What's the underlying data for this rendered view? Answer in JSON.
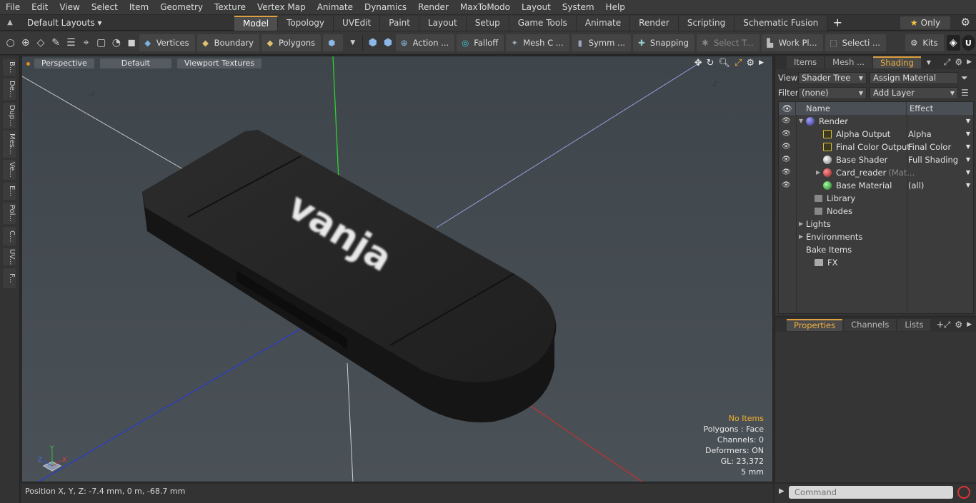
{
  "menu": [
    "File",
    "Edit",
    "View",
    "Select",
    "Item",
    "Geometry",
    "Texture",
    "Vertex Map",
    "Animate",
    "Dynamics",
    "Render",
    "MaxToModo",
    "Layout",
    "System",
    "Help"
  ],
  "layout": {
    "layouts_label": "Default Layouts ▾",
    "tabs": [
      "Model",
      "Topology",
      "UVEdit",
      "Paint",
      "Layout",
      "Setup",
      "Game Tools",
      "Animate",
      "Render",
      "Scripting",
      "Schematic Fusion"
    ],
    "active_tab": "Model",
    "only_label": "Only"
  },
  "toolbar": {
    "vertices": "Vertices",
    "boundary": "Boundary",
    "polygons": "Polygons",
    "action": "Action  ...",
    "falloff": "Falloff",
    "mesh": "Mesh C ...",
    "symm": "Symm ...",
    "snapping": "Snapping",
    "select_t": "Select T...",
    "work_pl": "Work Pl...",
    "selecti": "Selecti ...",
    "kits": "Kits"
  },
  "left_strip": [
    "B...",
    "De...",
    "Dup...",
    "Mes...",
    "Ve...",
    "E...",
    "Pol...",
    "C...",
    "UV...",
    "F..."
  ],
  "viewport": {
    "view": "Perspective",
    "shading": "Default",
    "textures": "Viewport Textures",
    "axis_neg_x": "-X",
    "axis_neg_z": "-Z",
    "model_text": "vanja",
    "info": {
      "items": "No Items",
      "polygons": "Polygons : Face",
      "channels": "Channels: 0",
      "deformers": "Deformers: ON",
      "gl": "GL: 23,372",
      "unit": "5 mm"
    },
    "gizmo_y": "Y",
    "gizmo_x": "X",
    "gizmo_z": "Z"
  },
  "status": {
    "position": "Position X, Y, Z:   -7.4 mm, 0 m, -68.7 mm"
  },
  "shading_panel": {
    "tabs": [
      "Items",
      "Mesh ...",
      "Shading"
    ],
    "active_tab": "Shading",
    "view_label": "View",
    "view_value": "Shader Tree",
    "assign_material": "Assign Material",
    "filter_label": "Filter",
    "filter_value": "(none)",
    "add_layer": "Add Layer",
    "col_name": "Name",
    "col_effect": "Effect",
    "rows": [
      {
        "name": "Render",
        "effect": "",
        "eye": true,
        "indent": 1,
        "expand": "▼",
        "icon": "render"
      },
      {
        "name": "Alpha Output",
        "effect": "Alpha",
        "eye": true,
        "indent": 3,
        "expand": "",
        "icon": "output"
      },
      {
        "name": "Final Color Output",
        "effect": "Final Color",
        "eye": true,
        "indent": 3,
        "expand": "",
        "icon": "output"
      },
      {
        "name": "Base Shader",
        "effect": "Full Shading",
        "eye": true,
        "indent": 3,
        "expand": "",
        "icon": "shader"
      },
      {
        "name": "Card_reader",
        "sub": "(Mat...",
        "effect": "",
        "eye": true,
        "indent": 3,
        "expand": "▶",
        "icon": "material-red"
      },
      {
        "name": "Base Material",
        "effect": "(all)",
        "eye": true,
        "indent": 3,
        "expand": "",
        "icon": "material-green"
      },
      {
        "name": "Library",
        "effect": "",
        "eye": false,
        "indent": 2,
        "expand": "",
        "icon": "folder"
      },
      {
        "name": "Nodes",
        "effect": "",
        "eye": false,
        "indent": 2,
        "expand": "",
        "icon": "folder"
      },
      {
        "name": "Lights",
        "effect": "",
        "eye": false,
        "indent": 1,
        "expand": "▶",
        "icon": ""
      },
      {
        "name": "Environments",
        "effect": "",
        "eye": false,
        "indent": 1,
        "expand": "▶",
        "icon": ""
      },
      {
        "name": "Bake Items",
        "effect": "",
        "eye": false,
        "indent": 1,
        "expand": "",
        "icon": ""
      },
      {
        "name": "FX",
        "effect": "",
        "eye": false,
        "indent": 2,
        "expand": "",
        "icon": "fx"
      }
    ]
  },
  "properties_panel": {
    "tabs": [
      "Properties",
      "Channels",
      "Lists"
    ],
    "active_tab": "Properties"
  },
  "command": {
    "placeholder": "Command"
  },
  "colors": {
    "accent": "#e0a040",
    "viewport_bg": "#434a50"
  }
}
